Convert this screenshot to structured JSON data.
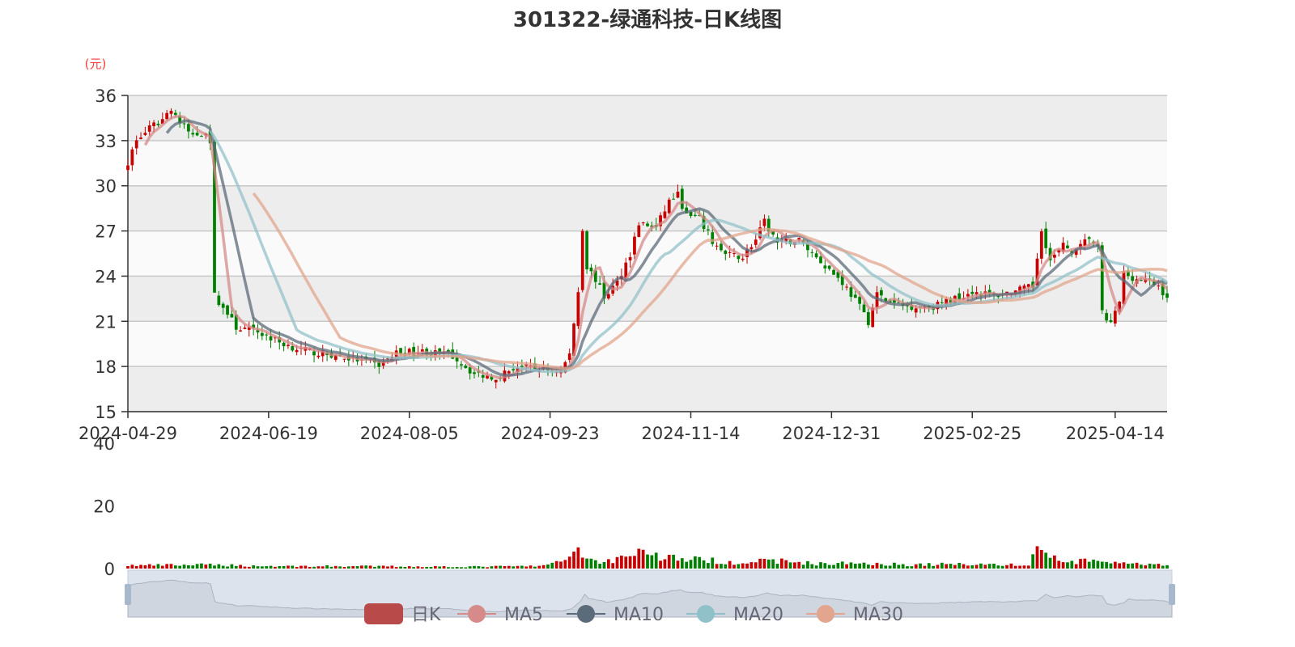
{
  "chart_data": {
    "type": "candlestick",
    "title": "301322-绿通科技-日K线图",
    "ylabel": "(元)",
    "ylim": [
      15,
      36
    ],
    "yticks": [
      "15",
      "18",
      "21",
      "24",
      "27",
      "30",
      "33",
      "36"
    ],
    "volume_ylim": [
      0,
      40
    ],
    "volume_yticks": [
      "0",
      "20",
      "40"
    ],
    "xticks": [
      "2024-04-29",
      "2024-06-19",
      "2024-08-05",
      "2024-09-23",
      "2024-11-14",
      "2024-12-31",
      "2025-02-25",
      "2025-04-14"
    ],
    "xtick_index": [
      0,
      32.5,
      65,
      97.5,
      130,
      162.5,
      195,
      228
    ],
    "trading_days": 241,
    "close_anchors": [
      [
        0,
        31.6
      ],
      [
        2,
        33
      ],
      [
        5,
        33.8
      ],
      [
        8,
        34.4
      ],
      [
        10,
        35.2
      ],
      [
        12,
        34.2
      ],
      [
        15,
        33.3
      ],
      [
        18,
        33.6
      ],
      [
        19,
        33
      ],
      [
        20,
        22.7
      ],
      [
        23,
        21.5
      ],
      [
        25,
        20.6
      ],
      [
        30,
        20.3
      ],
      [
        35,
        19.6
      ],
      [
        40,
        19.1
      ],
      [
        50,
        18.6
      ],
      [
        58,
        18.1
      ],
      [
        62,
        18.9
      ],
      [
        68,
        19
      ],
      [
        75,
        18.7
      ],
      [
        80,
        17.5
      ],
      [
        85,
        17.3
      ],
      [
        90,
        18
      ],
      [
        96,
        17.8
      ],
      [
        100,
        17.7
      ],
      [
        102,
        18.8
      ],
      [
        104,
        23
      ],
      [
        105,
        27.2
      ],
      [
        106,
        24.6
      ],
      [
        108,
        23.8
      ],
      [
        110,
        22.6
      ],
      [
        113,
        23.6
      ],
      [
        116,
        25.5
      ],
      [
        118,
        27.5
      ],
      [
        122,
        27.2
      ],
      [
        125,
        29
      ],
      [
        127,
        29.4
      ],
      [
        129,
        28
      ],
      [
        132,
        27.8
      ],
      [
        135,
        26.3
      ],
      [
        138,
        25.4
      ],
      [
        142,
        25.3
      ],
      [
        145,
        26.4
      ],
      [
        147,
        27.6
      ],
      [
        150,
        26.2
      ],
      [
        155,
        26.4
      ],
      [
        160,
        25
      ],
      [
        165,
        23.6
      ],
      [
        168,
        22.4
      ],
      [
        171,
        21
      ],
      [
        173,
        22.8
      ],
      [
        176,
        22.2
      ],
      [
        180,
        22
      ],
      [
        186,
        22
      ],
      [
        190,
        22.4
      ],
      [
        195,
        23
      ],
      [
        200,
        22.7
      ],
      [
        205,
        23
      ],
      [
        209,
        23.3
      ],
      [
        211,
        27.2
      ],
      [
        213,
        25
      ],
      [
        216,
        26
      ],
      [
        219,
        25.6
      ],
      [
        222,
        26.6
      ],
      [
        224,
        25.8
      ],
      [
        225,
        21.5
      ],
      [
        227,
        20.8
      ],
      [
        229,
        22.3
      ],
      [
        230,
        24.2
      ],
      [
        233,
        23.8
      ],
      [
        236,
        23.6
      ],
      [
        238,
        23.3
      ],
      [
        240,
        22.6
      ]
    ],
    "volume_anchors": [
      [
        0,
        1
      ],
      [
        20,
        1.2
      ],
      [
        30,
        0.8
      ],
      [
        60,
        0.7
      ],
      [
        80,
        0.6
      ],
      [
        95,
        0.8
      ],
      [
        100,
        2
      ],
      [
        103,
        5.5
      ],
      [
        104,
        7
      ],
      [
        106,
        3
      ],
      [
        110,
        2
      ],
      [
        115,
        4
      ],
      [
        118,
        6
      ],
      [
        122,
        4
      ],
      [
        130,
        3
      ],
      [
        140,
        2
      ],
      [
        150,
        2.5
      ],
      [
        160,
        1.5
      ],
      [
        170,
        1.8
      ],
      [
        180,
        1.2
      ],
      [
        195,
        1.5
      ],
      [
        208,
        1
      ],
      [
        210,
        7
      ],
      [
        213,
        4
      ],
      [
        216,
        2
      ],
      [
        225,
        2.5
      ],
      [
        230,
        1.5
      ],
      [
        240,
        1
      ]
    ],
    "series": [
      {
        "name": "日K"
      },
      {
        "name": "MA5",
        "period": 5
      },
      {
        "name": "MA10",
        "period": 10
      },
      {
        "name": "MA20",
        "period": 20
      },
      {
        "name": "MA30",
        "period": 30
      }
    ],
    "legend_position": "bottom-center",
    "colors": {
      "up": "#c80000",
      "down": "#008000",
      "MA5": "#d68a8a",
      "MA10": "#5c6b7a",
      "MA20": "#91c1c8",
      "MA30": "#e2a58e",
      "axis_unit": "#ff3b3b"
    }
  }
}
